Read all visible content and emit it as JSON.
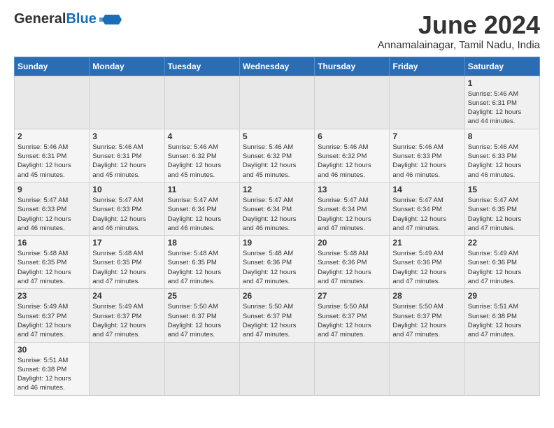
{
  "header": {
    "logo_general": "General",
    "logo_blue": "Blue",
    "main_title": "June 2024",
    "sub_title": "Annamalainagar, Tamil Nadu, India"
  },
  "weekdays": [
    "Sunday",
    "Monday",
    "Tuesday",
    "Wednesday",
    "Thursday",
    "Friday",
    "Saturday"
  ],
  "weeks": [
    {
      "days": [
        {
          "num": "",
          "info": ""
        },
        {
          "num": "",
          "info": ""
        },
        {
          "num": "",
          "info": ""
        },
        {
          "num": "",
          "info": ""
        },
        {
          "num": "",
          "info": ""
        },
        {
          "num": "",
          "info": ""
        },
        {
          "num": "1",
          "info": "Sunrise: 5:46 AM\nSunset: 6:31 PM\nDaylight: 12 hours\nand 44 minutes."
        }
      ]
    },
    {
      "days": [
        {
          "num": "2",
          "info": "Sunrise: 5:46 AM\nSunset: 6:31 PM\nDaylight: 12 hours\nand 45 minutes."
        },
        {
          "num": "3",
          "info": "Sunrise: 5:46 AM\nSunset: 6:31 PM\nDaylight: 12 hours\nand 45 minutes."
        },
        {
          "num": "4",
          "info": "Sunrise: 5:46 AM\nSunset: 6:32 PM\nDaylight: 12 hours\nand 45 minutes."
        },
        {
          "num": "5",
          "info": "Sunrise: 5:46 AM\nSunset: 6:32 PM\nDaylight: 12 hours\nand 45 minutes."
        },
        {
          "num": "6",
          "info": "Sunrise: 5:46 AM\nSunset: 6:32 PM\nDaylight: 12 hours\nand 46 minutes."
        },
        {
          "num": "7",
          "info": "Sunrise: 5:46 AM\nSunset: 6:33 PM\nDaylight: 12 hours\nand 46 minutes."
        },
        {
          "num": "8",
          "info": "Sunrise: 5:46 AM\nSunset: 6:33 PM\nDaylight: 12 hours\nand 46 minutes."
        }
      ]
    },
    {
      "days": [
        {
          "num": "9",
          "info": "Sunrise: 5:47 AM\nSunset: 6:33 PM\nDaylight: 12 hours\nand 46 minutes."
        },
        {
          "num": "10",
          "info": "Sunrise: 5:47 AM\nSunset: 6:33 PM\nDaylight: 12 hours\nand 46 minutes."
        },
        {
          "num": "11",
          "info": "Sunrise: 5:47 AM\nSunset: 6:34 PM\nDaylight: 12 hours\nand 46 minutes."
        },
        {
          "num": "12",
          "info": "Sunrise: 5:47 AM\nSunset: 6:34 PM\nDaylight: 12 hours\nand 46 minutes."
        },
        {
          "num": "13",
          "info": "Sunrise: 5:47 AM\nSunset: 6:34 PM\nDaylight: 12 hours\nand 47 minutes."
        },
        {
          "num": "14",
          "info": "Sunrise: 5:47 AM\nSunset: 6:34 PM\nDaylight: 12 hours\nand 47 minutes."
        },
        {
          "num": "15",
          "info": "Sunrise: 5:47 AM\nSunset: 6:35 PM\nDaylight: 12 hours\nand 47 minutes."
        }
      ]
    },
    {
      "days": [
        {
          "num": "16",
          "info": "Sunrise: 5:48 AM\nSunset: 6:35 PM\nDaylight: 12 hours\nand 47 minutes."
        },
        {
          "num": "17",
          "info": "Sunrise: 5:48 AM\nSunset: 6:35 PM\nDaylight: 12 hours\nand 47 minutes."
        },
        {
          "num": "18",
          "info": "Sunrise: 5:48 AM\nSunset: 6:35 PM\nDaylight: 12 hours\nand 47 minutes."
        },
        {
          "num": "19",
          "info": "Sunrise: 5:48 AM\nSunset: 6:36 PM\nDaylight: 12 hours\nand 47 minutes."
        },
        {
          "num": "20",
          "info": "Sunrise: 5:48 AM\nSunset: 6:36 PM\nDaylight: 12 hours\nand 47 minutes."
        },
        {
          "num": "21",
          "info": "Sunrise: 5:49 AM\nSunset: 6:36 PM\nDaylight: 12 hours\nand 47 minutes."
        },
        {
          "num": "22",
          "info": "Sunrise: 5:49 AM\nSunset: 6:36 PM\nDaylight: 12 hours\nand 47 minutes."
        }
      ]
    },
    {
      "days": [
        {
          "num": "23",
          "info": "Sunrise: 5:49 AM\nSunset: 6:37 PM\nDaylight: 12 hours\nand 47 minutes."
        },
        {
          "num": "24",
          "info": "Sunrise: 5:49 AM\nSunset: 6:37 PM\nDaylight: 12 hours\nand 47 minutes."
        },
        {
          "num": "25",
          "info": "Sunrise: 5:50 AM\nSunset: 6:37 PM\nDaylight: 12 hours\nand 47 minutes."
        },
        {
          "num": "26",
          "info": "Sunrise: 5:50 AM\nSunset: 6:37 PM\nDaylight: 12 hours\nand 47 minutes."
        },
        {
          "num": "27",
          "info": "Sunrise: 5:50 AM\nSunset: 6:37 PM\nDaylight: 12 hours\nand 47 minutes."
        },
        {
          "num": "28",
          "info": "Sunrise: 5:50 AM\nSunset: 6:37 PM\nDaylight: 12 hours\nand 47 minutes."
        },
        {
          "num": "29",
          "info": "Sunrise: 5:51 AM\nSunset: 6:38 PM\nDaylight: 12 hours\nand 47 minutes."
        }
      ]
    },
    {
      "days": [
        {
          "num": "30",
          "info": "Sunrise: 5:51 AM\nSunset: 6:38 PM\nDaylight: 12 hours\nand 46 minutes."
        },
        {
          "num": "",
          "info": ""
        },
        {
          "num": "",
          "info": ""
        },
        {
          "num": "",
          "info": ""
        },
        {
          "num": "",
          "info": ""
        },
        {
          "num": "",
          "info": ""
        },
        {
          "num": "",
          "info": ""
        }
      ]
    }
  ]
}
